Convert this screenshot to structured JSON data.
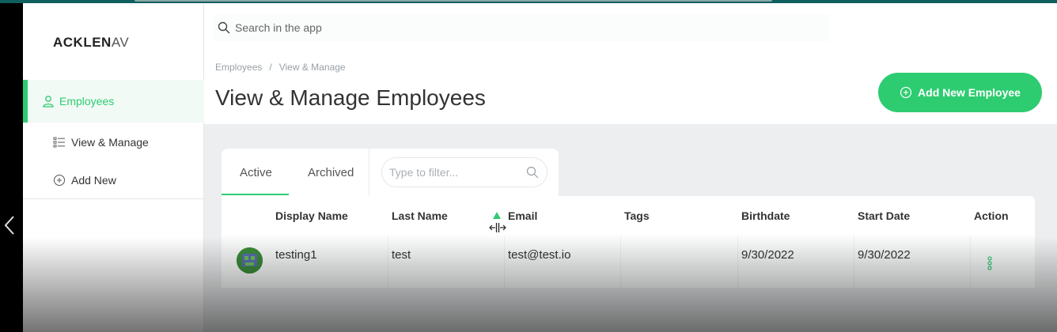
{
  "app": {
    "logo_bold": "ACKLEN",
    "logo_light": "AV"
  },
  "sidebar": {
    "main_item": "Employees",
    "sub_items": [
      {
        "label": "View & Manage",
        "icon": "list-icon"
      },
      {
        "label": "Add New",
        "icon": "plus-circle-icon"
      }
    ]
  },
  "search": {
    "placeholder": "Search in the app"
  },
  "header": {
    "breadcrumb": [
      "Employees",
      "View & Manage"
    ],
    "breadcrumb_separator": "/",
    "title": "View & Manage Employees",
    "add_button": "Add New Employee"
  },
  "tabs": {
    "items": [
      "Active",
      "Archived"
    ],
    "active": "Active",
    "filter_placeholder": "Type to filter..."
  },
  "table": {
    "columns": [
      "Display Name",
      "Last Name",
      "Email",
      "Tags",
      "Birthdate",
      "Start Date",
      "Action"
    ],
    "sorted_column": "Email",
    "rows": [
      {
        "display_name": "testing1",
        "last_name": "test",
        "email": "test@test.io",
        "tags": "",
        "birthdate": "9/30/2022",
        "start_date": "9/30/2022"
      }
    ]
  },
  "colors": {
    "accent": "#2ecc71",
    "topbar": "#0f5f5f",
    "content_bg": "#eceeef"
  }
}
